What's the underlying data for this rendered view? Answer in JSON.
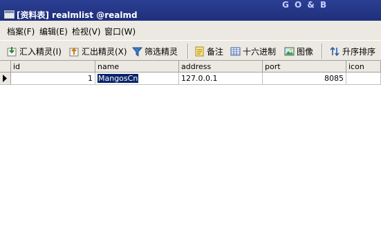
{
  "window": {
    "title": "[资料表] realmlist @realmd",
    "title_decoration": "G O & B"
  },
  "menu": [
    {
      "label": "档案(F)"
    },
    {
      "label": "编辑(E)"
    },
    {
      "label": "检视(V)"
    },
    {
      "label": "窗口(W)"
    }
  ],
  "toolbar": {
    "import_label": "汇入精灵(I)",
    "export_label": "汇出精灵(X)",
    "filter_label": "筛选精灵",
    "memo_label": "备注",
    "hex_label": "十六进制",
    "image_label": "图像",
    "sort_label": "升序排序"
  },
  "table": {
    "columns": [
      "id",
      "name",
      "address",
      "port",
      "icon"
    ],
    "rows": [
      {
        "id": "1",
        "name": "MangosCn",
        "address": "127.0.0.1",
        "port": "8085",
        "icon": ""
      }
    ]
  },
  "colors": {
    "titlebar": "#1f2f7a",
    "selection": "#0a246a",
    "chrome": "#ece9e2"
  },
  "icons": [
    "table-icon",
    "import-icon",
    "export-icon",
    "filter-icon",
    "memo-icon",
    "hex-icon",
    "image-icon",
    "sort-icon",
    "row-pointer-icon"
  ]
}
